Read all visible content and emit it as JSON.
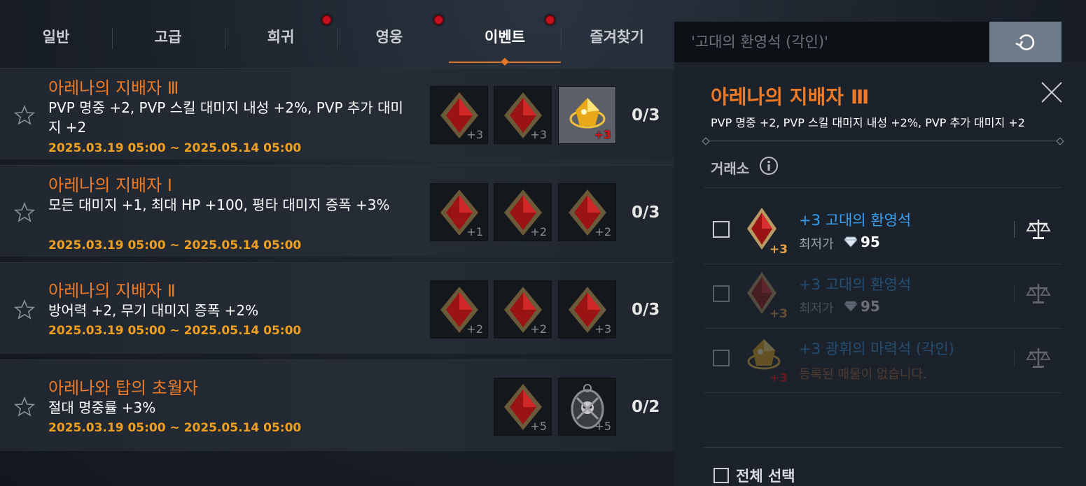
{
  "tabs": [
    {
      "label": "일반",
      "active": false,
      "badge": false
    },
    {
      "label": "고급",
      "active": false,
      "badge": false
    },
    {
      "label": "희귀",
      "active": false,
      "badge": true
    },
    {
      "label": "영웅",
      "active": false,
      "badge": true
    },
    {
      "label": "이벤트",
      "active": true,
      "badge": true
    },
    {
      "label": "즐겨찾기",
      "active": false,
      "badge": false
    }
  ],
  "search": {
    "value": "'고대의 환영석 (각인)'"
  },
  "rows": [
    {
      "title": "아레나의 지배자 Ⅲ",
      "desc": "PVP 명중 +2, PVP 스킬 대미지 내성 +2%, PVP 추가 대미지 +2",
      "date": "2025.03.19 05:00 ~ 2025.05.14 05:00",
      "count": "0/3",
      "slots": [
        {
          "icon": "red-gem-icon",
          "level": "+3"
        },
        {
          "icon": "red-gem-icon",
          "level": "+3"
        },
        {
          "icon": "gold-magic-stone-icon",
          "level": "+3"
        }
      ]
    },
    {
      "title": "아레나의 지배자 Ⅰ",
      "desc": "모든 대미지 +1, 최대 HP +100, 평타 대미지 증폭 +3%",
      "date": "2025.03.19 05:00 ~ 2025.05.14 05:00",
      "count": "0/3",
      "slots": [
        {
          "icon": "red-gem-icon",
          "level": "+1"
        },
        {
          "icon": "red-gem-icon",
          "level": "+2"
        },
        {
          "icon": "red-gem-icon",
          "level": "+2"
        }
      ]
    },
    {
      "title": "아레나의 지배자 Ⅱ",
      "desc": "방어력 +2, 무기 대미지 증폭 +2%",
      "date": "2025.03.19 05:00 ~ 2025.05.14 05:00",
      "count": "0/3",
      "slots": [
        {
          "icon": "red-gem-icon",
          "level": "+2"
        },
        {
          "icon": "red-gem-icon",
          "level": "+2"
        },
        {
          "icon": "red-gem-icon",
          "level": "+3"
        }
      ]
    },
    {
      "title": "아레나와 탑의 초월자",
      "desc": "절대 명중률 +3%",
      "date": "2025.03.19 05:00 ~ 2025.05.14 05:00",
      "count": "0/2",
      "slots": [
        {
          "icon": "red-gem-icon",
          "level": "+5"
        },
        {
          "icon": "skull-amulet-icon",
          "level": "+5"
        }
      ]
    }
  ],
  "panel": {
    "title": "아레나의 지배자 Ⅲ",
    "desc": "PVP 명중 +2, PVP 스킬 대미지 내성 +2%, PVP 추가 대미지 +2",
    "market_label": "거래소",
    "items": [
      {
        "name": "+3 고대의 환영석",
        "icon": "red-gem-icon",
        "level": "+3",
        "price_label": "최저가",
        "price": "95",
        "empty_text": "",
        "dim": false
      },
      {
        "name": "+3 고대의 환영석",
        "icon": "red-gem-icon",
        "level": "+3",
        "price_label": "최저가",
        "price": "95",
        "empty_text": "",
        "dim": true
      },
      {
        "name": "+3 광휘의 마력석 (각인)",
        "icon": "gold-magic-stone-icon",
        "level": "+3",
        "price_label": "",
        "price": "",
        "empty_text": "등록된 매물이 없습니다.",
        "dim": true
      }
    ],
    "select_all": "전체 선택"
  },
  "colors": {
    "accent": "#ec7a26",
    "date": "#f0a020",
    "link": "#3a9ff0",
    "badge": "#c8101c"
  }
}
